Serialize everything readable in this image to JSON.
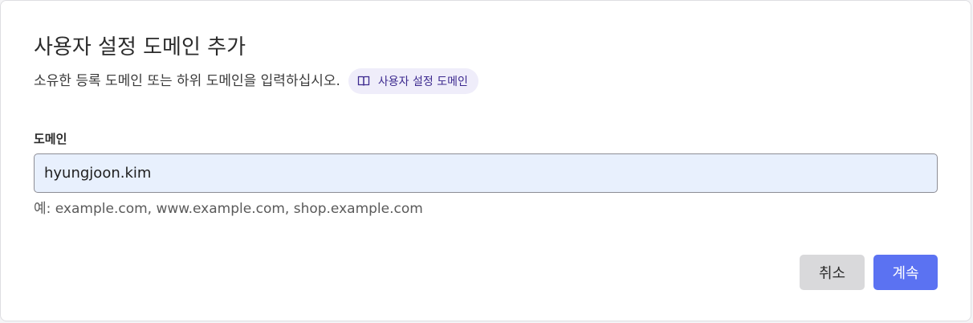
{
  "dialog": {
    "title": "사용자 설정 도메인 추가",
    "subtitle": "소유한 등록 도메인 또는 하위 도메인을 입력하십시오.",
    "doc_link": {
      "label": "사용자 설정 도메인",
      "icon": "book-icon"
    }
  },
  "form": {
    "domain_label": "도메인",
    "domain_value": "hyungjoon.kim",
    "domain_hint": "예: example.com, www.example.com, shop.example.com"
  },
  "actions": {
    "cancel_label": "취소",
    "continue_label": "계속"
  },
  "colors": {
    "primary": "#5b72f2",
    "secondary": "#d9d9db",
    "link_bg": "#efedfa",
    "link_text": "#3d2a8f",
    "input_bg": "#e8f0fd"
  }
}
